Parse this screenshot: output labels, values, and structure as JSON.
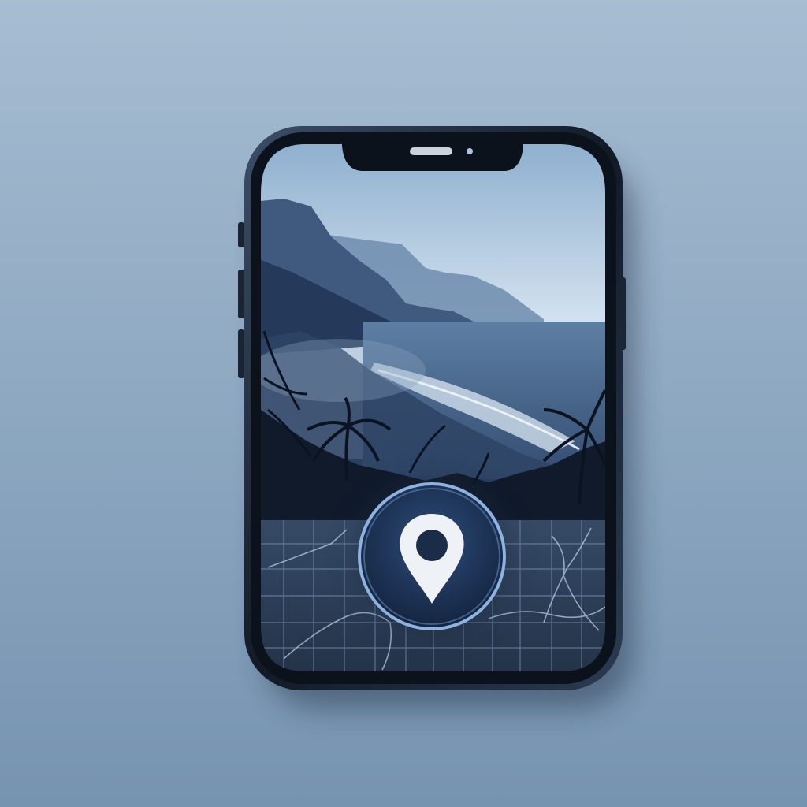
{
  "colors": {
    "background": "#93acc3",
    "phone_frame": "#1a2433",
    "sky_top": "#9ab6d2",
    "sky_bottom": "#dbe8f3",
    "sea": "#4d6c92",
    "map_tile": "#2c3f58",
    "pin_button": "#1c3254",
    "pin_ring": "#8fb3e0",
    "pin_marker": "#eef2f7"
  },
  "icons": {
    "location_pin": "location-pin-icon"
  }
}
